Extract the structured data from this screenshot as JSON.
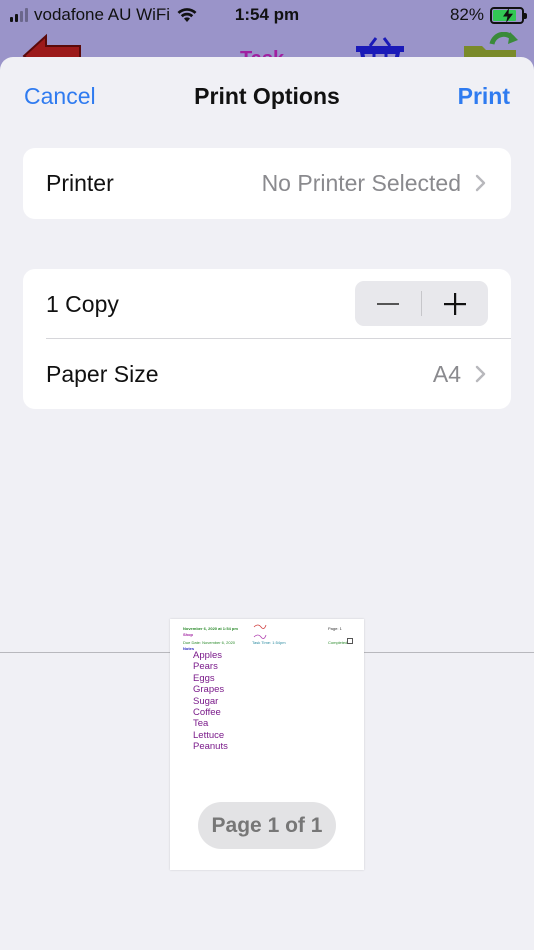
{
  "status_bar": {
    "carrier": "vodafone AU WiFi",
    "time": "1:54 pm",
    "battery_percent": "82%",
    "battery_level": 0.82
  },
  "background_app": {
    "task_label": "Task"
  },
  "sheet": {
    "cancel_label": "Cancel",
    "title": "Print Options",
    "print_label": "Print",
    "printer": {
      "label": "Printer",
      "value": "No Printer Selected"
    },
    "copies": {
      "label": "1 Copy"
    },
    "paper_size": {
      "label": "Paper Size",
      "value": "A4"
    },
    "preview": {
      "page_indicator": "Page 1 of 1",
      "header_date": "November 6, 2020 at 1:54 pm",
      "header_title": "Shop",
      "page_number": "Page: 1",
      "due_date": "Due Date: November 6, 2020",
      "task_time": "Task Time: 1:54pm",
      "completed": "Completed",
      "notes_label": "Notes",
      "items": [
        "Apples",
        "Pears",
        "Eggs",
        "Grapes",
        "Sugar",
        "Coffee",
        "Tea",
        "Lettuce",
        "Peanuts"
      ]
    }
  },
  "colors": {
    "accent": "#2f7bf0",
    "sheet_bg": "#f0f0f5",
    "list_text": "#7a1a8a"
  }
}
